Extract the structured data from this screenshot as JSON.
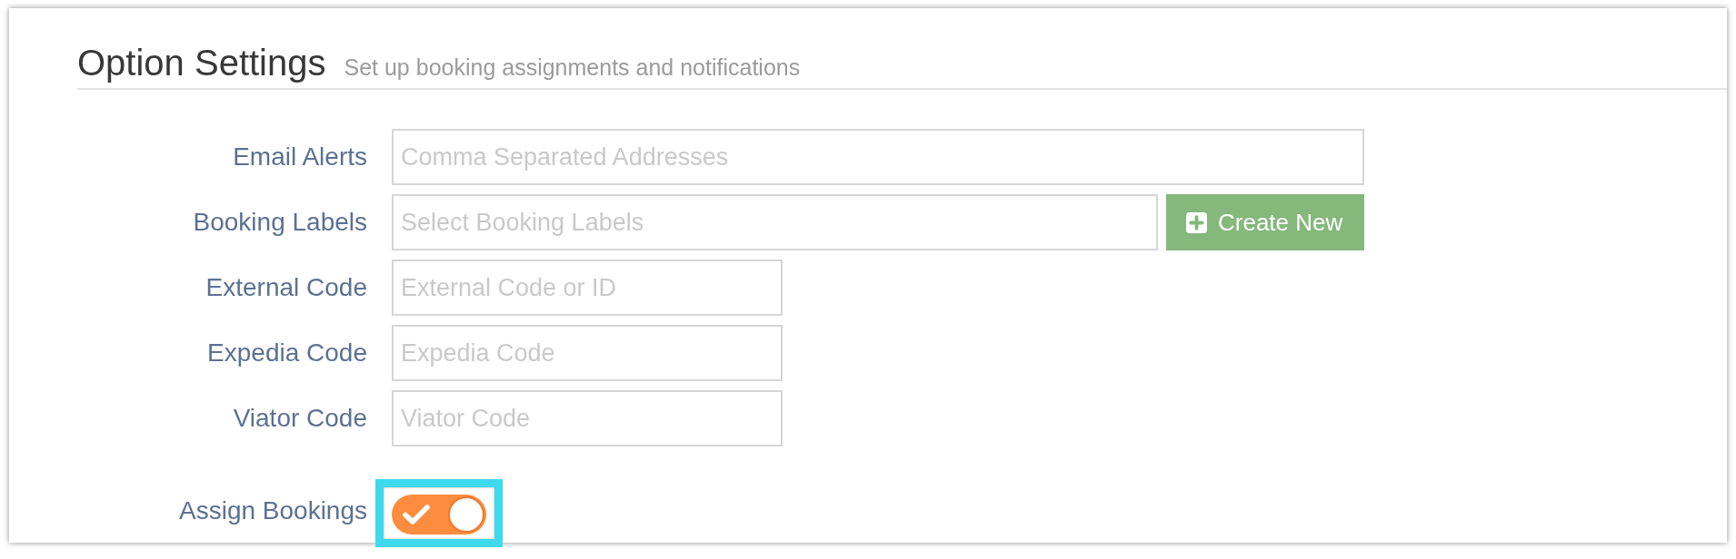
{
  "header": {
    "title": "Option Settings",
    "subtitle": "Set up booking assignments and notifications"
  },
  "fields": [
    {
      "label": "Email Alerts",
      "kind": "list",
      "placeholder": "Comma Separated Addresses"
    },
    {
      "label": "Booking Labels",
      "kind": "tags",
      "placeholder": "Select Booking Labels",
      "button": {
        "label": "Create New"
      }
    },
    {
      "label": "External Code",
      "kind": "code",
      "placeholder": "External Code or ID"
    },
    {
      "label": "Expedia Code",
      "kind": "code",
      "placeholder": "Expedia Code"
    },
    {
      "label": "Viator Code",
      "kind": "code",
      "placeholder": "Viator Code"
    }
  ],
  "assign_bookings": {
    "label": "Assign Bookings",
    "on": true,
    "highlighted": true
  }
}
